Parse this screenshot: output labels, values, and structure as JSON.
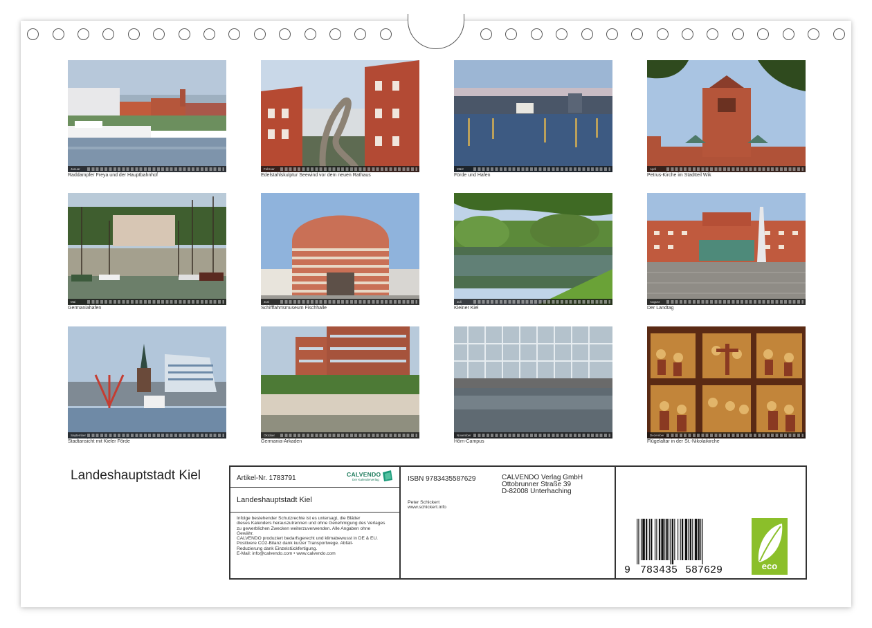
{
  "title": "Landeshauptstadt Kiel",
  "photos": [
    {
      "month": "Januar",
      "caption": "Raddampfer Freya und der Hauptbahnhof"
    },
    {
      "month": "Februar",
      "caption": "Edelstahlskulptur Seewind vor dem neuen Rathaus"
    },
    {
      "month": "März",
      "caption": "Förde und Hafen"
    },
    {
      "month": "April",
      "caption": "Petrus-Kirche im Stadtteil Wik"
    },
    {
      "month": "Mai",
      "caption": "Germaniahafen"
    },
    {
      "month": "Juni",
      "caption": "Schifffahrtsmuseum Fischhalle"
    },
    {
      "month": "Juli",
      "caption": "Kleiner Kiel"
    },
    {
      "month": "August",
      "caption": "Der Landtag"
    },
    {
      "month": "September",
      "caption": "Stadtansicht mit Kieler Förde"
    },
    {
      "month": "Oktober",
      "caption": "Germania-Arkaden"
    },
    {
      "month": "November",
      "caption": "Hörn-Campus"
    },
    {
      "month": "Dezember",
      "caption": "Flügelaltar in der St.-Nikolaikirche"
    }
  ],
  "imprint": {
    "article": "Artikel-Nr. 1783791",
    "brand": "CALVENDO",
    "brand_sub": "Der Kalenderverlag",
    "subtitle": "Landeshauptstadt Kiel",
    "legal_lines": [
      "Infolge bestehender Schutzrechte ist es untersagt, die Blätter",
      "dieses Kalenders herauszutrennen und ohne Genehmigung des Verlages",
      "zu gewerblichen Zwecken weiterzuverwenden. Alle Angaben ohne",
      "Gewähr.",
      "CALVENDO produziert bedarfsgerecht und klimabewusst in DE & EU.",
      "Positivere CO2-Bilanz dank kurzer Transportwege. Abfall-",
      "Reduzierung dank Einzelstückfertigung.",
      "E-Mail: info@calvendo.com • www.calvendo.com"
    ],
    "isbn": "ISBN 9783435587629",
    "publisher_lines": [
      "CALVENDO Verlag GmbH",
      "Ottobrunner Straße 39",
      "D-82008 Unterhaching"
    ],
    "author_lines": [
      "Peter Schickert",
      "www.schickert.info"
    ],
    "barcode_digits": [
      "9",
      "783435",
      "587629"
    ],
    "eco_label": "eco"
  },
  "colors": {
    "eco_green": "#8bbf2a",
    "brand_green": "#1b7a5a",
    "panel_border": "#333333"
  }
}
